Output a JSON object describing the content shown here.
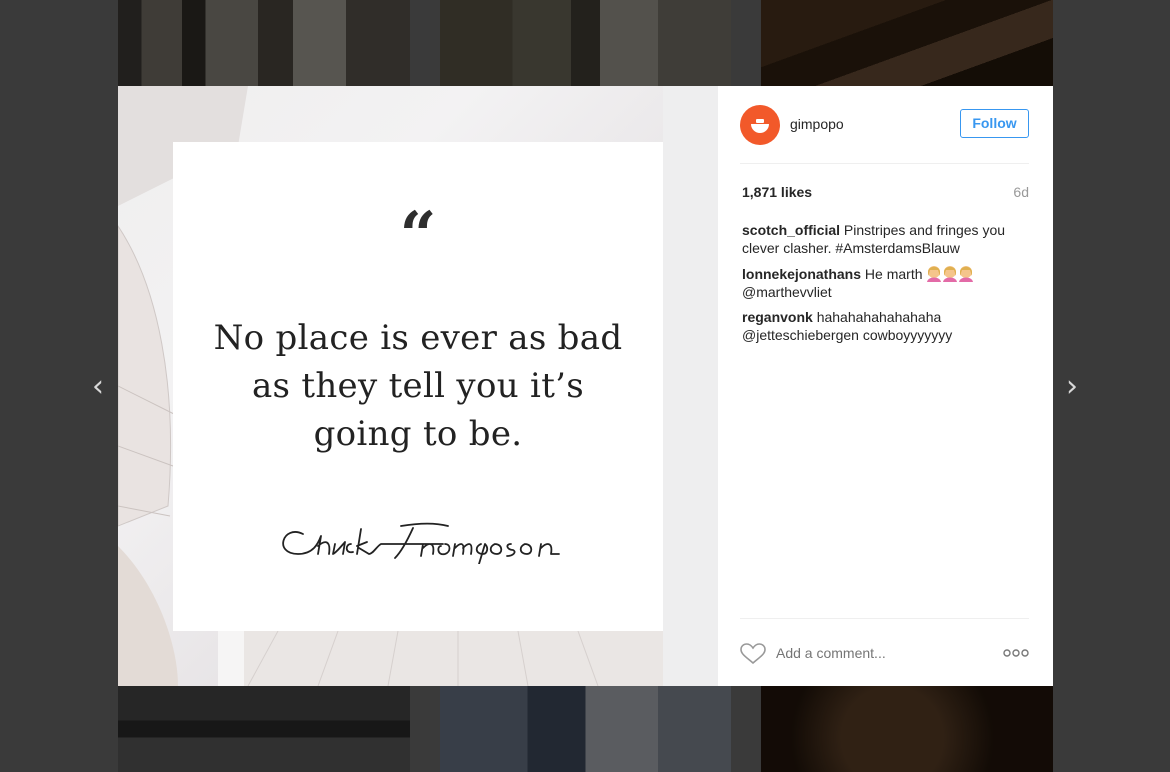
{
  "post": {
    "quote_mark": "“",
    "quote_text": "No place is ever as bad as they tell you it’s going to be.",
    "signature": "Chuck Thompson"
  },
  "account": {
    "username": "gimpopo",
    "follow_label": "Follow",
    "avatar_color": "#f2592a"
  },
  "stats": {
    "likes": "1,871 likes",
    "age": "6d"
  },
  "comments": [
    {
      "user": "scotch_official",
      "text": "Pinstripes and fringes you clever clasher. #AmsterdamsBlauw"
    },
    {
      "user": "lonnekejonathans",
      "text": "He marth",
      "emoji": [
        "person-icon",
        "person-icon",
        "person-icon"
      ],
      "text2": "@marthevvliet"
    },
    {
      "user": "reganvonk",
      "text": "hahahahahahahaha @jetteschiebergen cowboyyyyyyy"
    }
  ],
  "footer": {
    "comment_placeholder": "Add a comment...",
    "heart_icon": "heart-icon",
    "more_icon": "more-options-icon"
  },
  "nav": {
    "prev_glyph": "‹",
    "next_glyph": "›"
  },
  "colors": {
    "follow_blue": "#3897f0",
    "brand_orange": "#f2592a"
  }
}
